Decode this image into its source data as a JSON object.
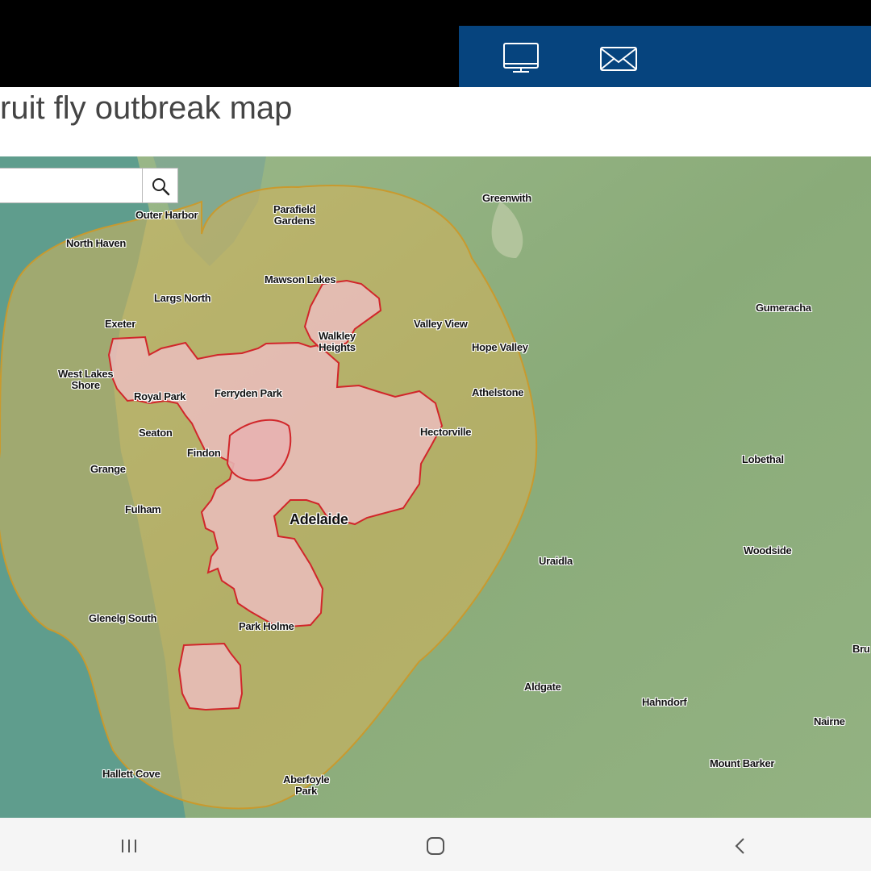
{
  "page": {
    "title": "ruit fly outbreak map"
  },
  "header": {
    "icons": [
      "computer-icon",
      "mail-icon"
    ],
    "accent": "#06447e"
  },
  "search": {
    "placeholder": "",
    "icon": "search-icon"
  },
  "map": {
    "colors": {
      "outbreak_zone": "#d6b25a",
      "affected_area": "#e8b9b8",
      "affected_outline": "#c62828",
      "land": "#8fb07f",
      "water": "#5c9b8c"
    },
    "places": {
      "outer_harbor": "Outer Harbor",
      "parafield_gardens_1": "Parafield",
      "parafield_gardens_2": "Gardens",
      "greenwith": "Greenwith",
      "north_haven": "North Haven",
      "mawson_lakes": "Mawson Lakes",
      "largs_north": "Largs North",
      "gumeracha": "Gumeracha",
      "exeter": "Exeter",
      "walkley_heights_1": "Walkley",
      "walkley_heights_2": "Heights",
      "valley_view": "Valley View",
      "hope_valley": "Hope Valley",
      "west_lakes_shore_1": "West Lakes",
      "west_lakes_shore_2": "Shore",
      "royal_park": "Royal Park",
      "ferryden_park": "Ferryden Park",
      "athelstone": "Athelstone",
      "seaton": "Seaton",
      "hectorville": "Hectorville",
      "findon": "Findon",
      "lobethal": "Lobethal",
      "grange": "Grange",
      "fulham": "Fulham",
      "adelaide": "Adelaide",
      "uraidla": "Uraidla",
      "woodside": "Woodside",
      "glenelg_south": "Glenelg South",
      "park_holme": "Park Holme",
      "bru": "Bru",
      "aldgate": "Aldgate",
      "hahndorf": "Hahndorf",
      "nairne": "Nairne",
      "mount_barker": "Mount Barker",
      "hallett_cove": "Hallett Cove",
      "aberfoyle_park_1": "Aberfoyle",
      "aberfoyle_park_2": "Park"
    }
  },
  "navbar": {
    "buttons": [
      "recent-apps-icon",
      "home-icon",
      "back-icon"
    ]
  }
}
